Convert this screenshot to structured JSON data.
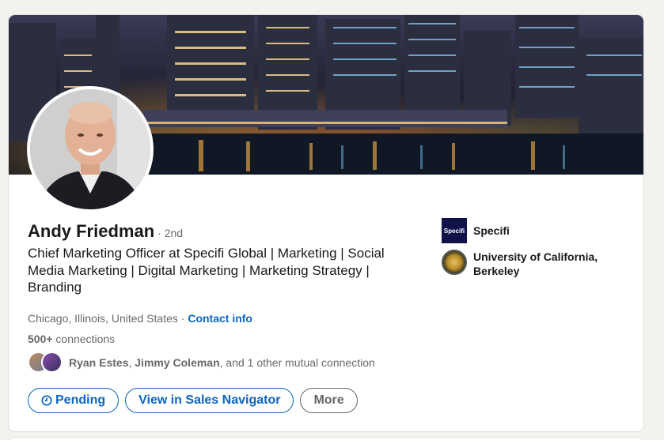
{
  "profile": {
    "name": "Andy Friedman",
    "degree": "· 2nd",
    "headline": "Chief Marketing Officer at Specifi Global | Marketing | Social Media Marketing | Digital Marketing | Marketing Strategy | Branding",
    "location": "Chicago, Illinois, United States",
    "location_separator": " · ",
    "contact_info_label": "Contact info",
    "connections_count": "500+",
    "connections_label": " connections",
    "mutual": {
      "name1": "Ryan Estes",
      "separator": ", ",
      "name2": "Jimmy Coleman",
      "rest": ", and 1 other mutual connection"
    }
  },
  "actions": {
    "pending_label": "Pending",
    "sales_nav_label": "View in Sales Navigator",
    "more_label": "More"
  },
  "orgs": [
    {
      "name": "Specifi",
      "logo_text": "Specifi"
    },
    {
      "name": "University of California, Berkeley"
    }
  ],
  "colors": {
    "accent": "#0a66c2",
    "background": "#f3f2ef"
  },
  "icons": {
    "pending": "clock-icon"
  }
}
